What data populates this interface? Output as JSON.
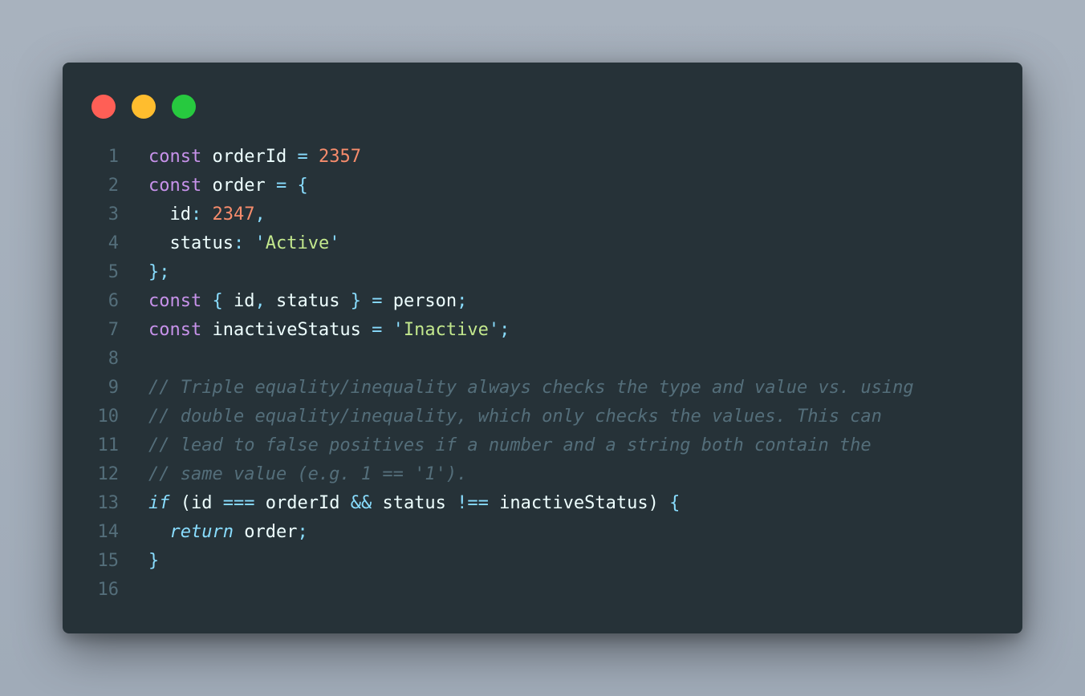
{
  "window": {
    "dots": [
      {
        "name": "close",
        "color": "#ff5f56"
      },
      {
        "name": "minimize",
        "color": "#ffbd2e"
      },
      {
        "name": "maximize",
        "color": "#27c93f"
      }
    ]
  },
  "code": {
    "line_numbers": [
      "1",
      "2",
      "3",
      "4",
      "5",
      "6",
      "7",
      "8",
      "9",
      "10",
      "11",
      "12",
      "13",
      "14",
      "15",
      "16"
    ],
    "lines": [
      [
        {
          "t": "kw",
          "v": "const"
        },
        {
          "t": "txt",
          "v": " orderId "
        },
        {
          "t": "op",
          "v": "="
        },
        {
          "t": "txt",
          "v": " "
        },
        {
          "t": "num",
          "v": "2357"
        }
      ],
      [
        {
          "t": "kw",
          "v": "const"
        },
        {
          "t": "txt",
          "v": " order "
        },
        {
          "t": "op",
          "v": "="
        },
        {
          "t": "txt",
          "v": " "
        },
        {
          "t": "pun",
          "v": "{"
        }
      ],
      [
        {
          "t": "txt",
          "v": "  id"
        },
        {
          "t": "pun",
          "v": ":"
        },
        {
          "t": "txt",
          "v": " "
        },
        {
          "t": "num",
          "v": "2347"
        },
        {
          "t": "pun",
          "v": ","
        }
      ],
      [
        {
          "t": "txt",
          "v": "  status"
        },
        {
          "t": "pun",
          "v": ":"
        },
        {
          "t": "txt",
          "v": " "
        },
        {
          "t": "pun",
          "v": "'"
        },
        {
          "t": "str",
          "v": "Active"
        },
        {
          "t": "pun",
          "v": "'"
        }
      ],
      [
        {
          "t": "pun",
          "v": "};"
        }
      ],
      [
        {
          "t": "kw",
          "v": "const"
        },
        {
          "t": "txt",
          "v": " "
        },
        {
          "t": "pun",
          "v": "{"
        },
        {
          "t": "txt",
          "v": " id"
        },
        {
          "t": "pun",
          "v": ","
        },
        {
          "t": "txt",
          "v": " status "
        },
        {
          "t": "pun",
          "v": "}"
        },
        {
          "t": "txt",
          "v": " "
        },
        {
          "t": "op",
          "v": "="
        },
        {
          "t": "txt",
          "v": " person"
        },
        {
          "t": "pun",
          "v": ";"
        }
      ],
      [
        {
          "t": "kw",
          "v": "const"
        },
        {
          "t": "txt",
          "v": " inactiveStatus "
        },
        {
          "t": "op",
          "v": "="
        },
        {
          "t": "txt",
          "v": " "
        },
        {
          "t": "pun",
          "v": "'"
        },
        {
          "t": "str",
          "v": "Inactive"
        },
        {
          "t": "pun",
          "v": "';"
        }
      ],
      [],
      [
        {
          "t": "cmt",
          "v": "// Triple equality/inequality always checks the type and value vs. using"
        }
      ],
      [
        {
          "t": "cmt",
          "v": "// double equality/inequality, which only checks the values. This can"
        }
      ],
      [
        {
          "t": "cmt",
          "v": "// lead to false positives if a number and a string both contain the"
        }
      ],
      [
        {
          "t": "cmt",
          "v": "// same value (e.g. 1 == '1')."
        }
      ],
      [
        {
          "t": "ctl",
          "v": "if"
        },
        {
          "t": "txt",
          "v": " (id "
        },
        {
          "t": "op",
          "v": "==="
        },
        {
          "t": "txt",
          "v": " orderId "
        },
        {
          "t": "op",
          "v": "&&"
        },
        {
          "t": "txt",
          "v": " status "
        },
        {
          "t": "op",
          "v": "!=="
        },
        {
          "t": "txt",
          "v": " inactiveStatus) "
        },
        {
          "t": "pun",
          "v": "{"
        }
      ],
      [
        {
          "t": "txt",
          "v": "  "
        },
        {
          "t": "ctl",
          "v": "return"
        },
        {
          "t": "txt",
          "v": " order"
        },
        {
          "t": "pun",
          "v": ";"
        }
      ],
      [
        {
          "t": "pun",
          "v": "}"
        }
      ],
      []
    ]
  }
}
